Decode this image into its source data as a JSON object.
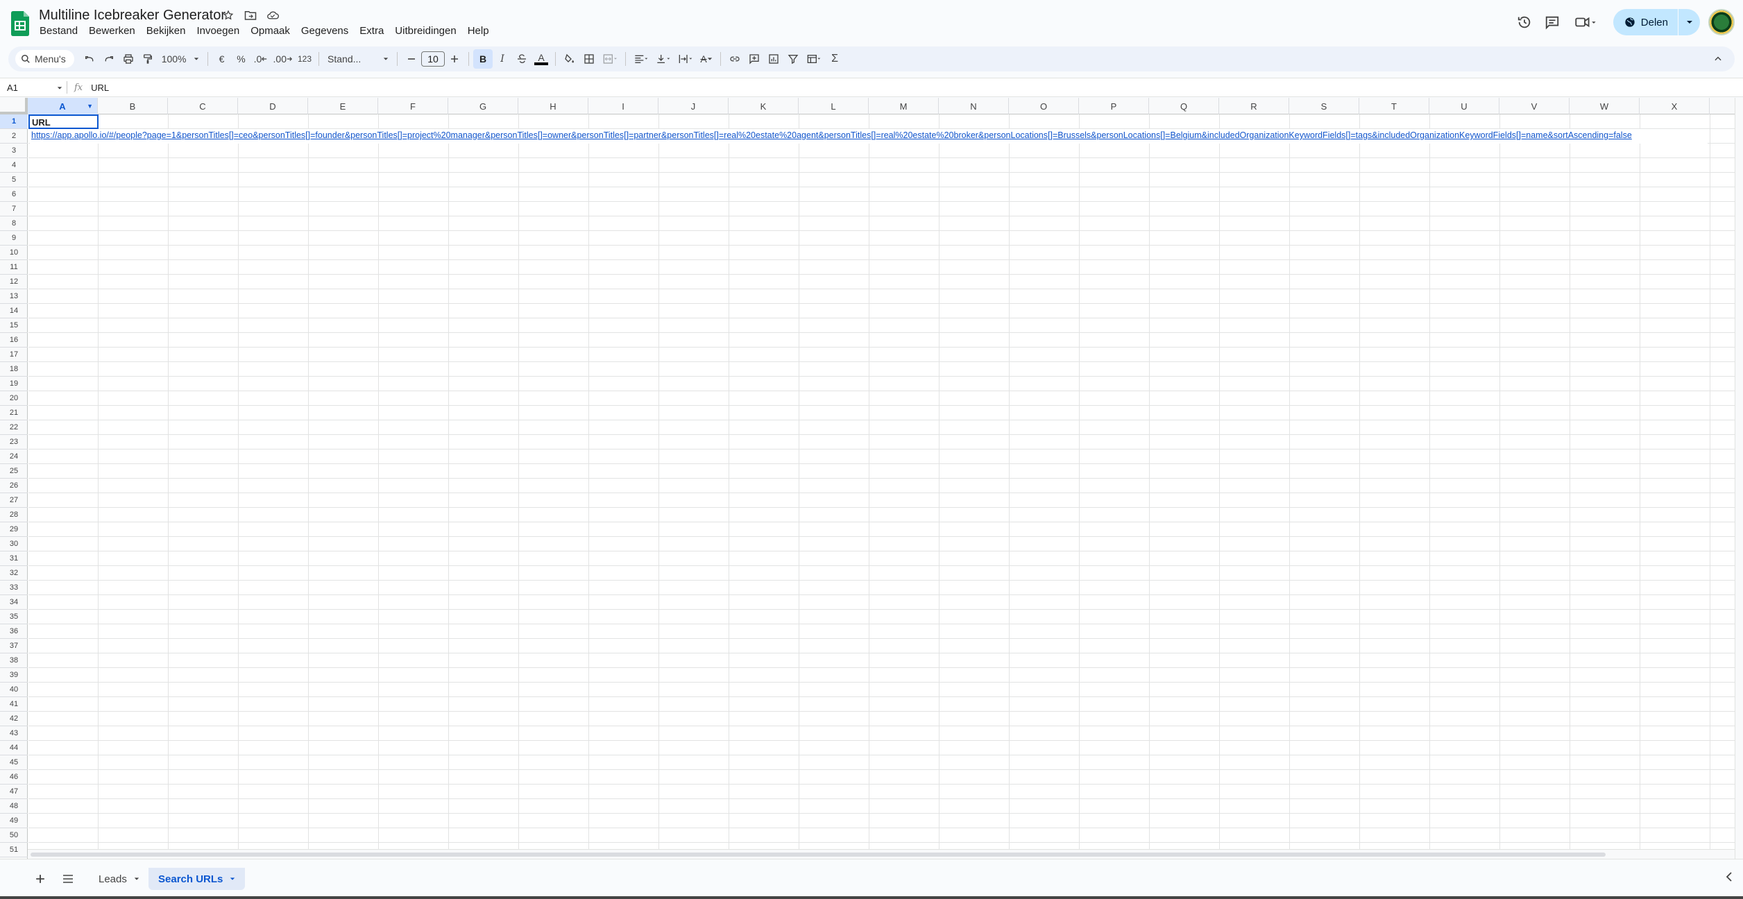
{
  "doc": {
    "title": "Multiline Icebreaker Generator"
  },
  "menu": [
    "Bestand",
    "Bewerken",
    "Bekijken",
    "Invoegen",
    "Opmaak",
    "Gegevens",
    "Extra",
    "Uitbreidingen",
    "Help"
  ],
  "share": {
    "label": "Delen"
  },
  "toolbar": {
    "search_label": "Menu's",
    "zoom": "100%",
    "currency": "€",
    "percent": "%",
    "dec_decrease": ".0",
    "dec_increase": ".00",
    "number_format": "123",
    "font": "Stand...",
    "font_size": "10",
    "bold": "B",
    "italic": "I",
    "text_color": "A",
    "rotate": "A",
    "sum": "Σ"
  },
  "formula_bar": {
    "cell_ref": "A1",
    "fx": "fx",
    "value": "URL"
  },
  "columns": [
    "A",
    "B",
    "C",
    "D",
    "E",
    "F",
    "G",
    "H",
    "I",
    "J",
    "K",
    "L",
    "M",
    "N",
    "O",
    "P",
    "Q",
    "R",
    "S",
    "T",
    "U",
    "V",
    "W",
    "X"
  ],
  "rows": [
    "1",
    "2",
    "3",
    "4",
    "5",
    "6",
    "7",
    "8",
    "9",
    "10",
    "11",
    "12",
    "13",
    "14",
    "15",
    "16",
    "17",
    "18",
    "19",
    "20",
    "21",
    "22",
    "23",
    "24",
    "25",
    "26",
    "27",
    "28",
    "29",
    "30",
    "31",
    "32",
    "33",
    "34",
    "35",
    "36",
    "37",
    "38",
    "39",
    "40",
    "41",
    "42",
    "43",
    "44",
    "45",
    "46",
    "47",
    "48",
    "49",
    "50",
    "51"
  ],
  "cells": {
    "A1": "URL",
    "A2": "https://app.apollo.io/#/people?page=1&personTitles[]=ceo&personTitles[]=founder&personTitles[]=project%20manager&personTitles[]=owner&personTitles[]=partner&personTitles[]=real%20estate%20agent&personTitles[]=real%20estate%20broker&personLocations[]=Brussels&personLocations[]=Belgium&includedOrganizationKeywordFields[]=tags&includedOrganizationKeywordFields[]=name&sortAscending=false"
  },
  "sheets": [
    {
      "name": "Leads",
      "active": false
    },
    {
      "name": "Search URLs",
      "active": true
    }
  ],
  "colors": {
    "accent": "#0b57d0",
    "share_bg": "#c2e7ff",
    "link": "#1155cc",
    "logo": "#0f9d58"
  }
}
